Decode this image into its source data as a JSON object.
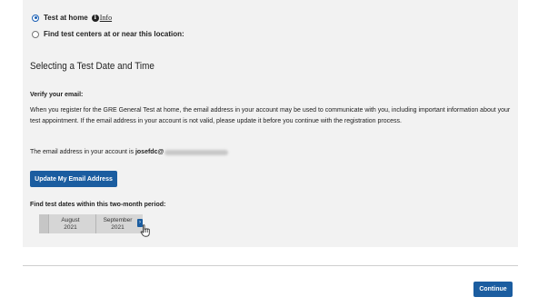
{
  "location_options": {
    "home_label": "Test at home",
    "info_link": "Info",
    "centers_label": "Find test centers at or near this location:"
  },
  "section": {
    "title": "Selecting a Test Date and Time"
  },
  "verify": {
    "heading": "Verify your email:",
    "paragraph": "When you register for the GRE General Test at home, the email address in your account may be used to communicate with you, including important information about your test appointment. If the email address in your account is not valid, please update it before you continue with the registration process.",
    "email_prefix": "The email address in your account is",
    "email_visible": "josefdc@",
    "update_button": "Update My Email Address"
  },
  "date_picker": {
    "heading": "Find test dates within this two-month period:",
    "months": [
      {
        "name": "August",
        "year": "2021"
      },
      {
        "name": "September",
        "year": "2021"
      }
    ],
    "next_arrow": "›"
  },
  "footer": {
    "continue_button": "Continue"
  },
  "colors": {
    "primary": "#1b5da0",
    "panel_bg": "#f2f2f2"
  }
}
